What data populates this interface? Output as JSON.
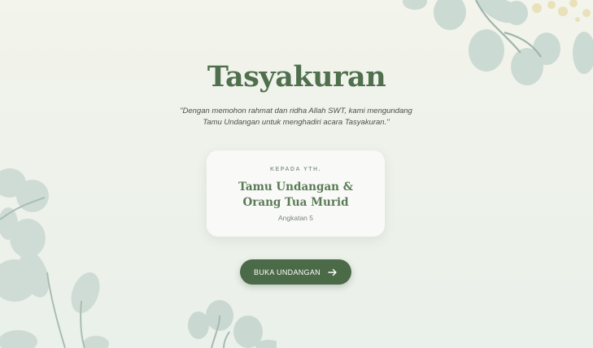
{
  "hero": {
    "title": "Tasyakuran",
    "quote_line1": "\"Dengan memohon rahmat dan ridha Allah SWT, kami mengundang",
    "quote_line2": "Tamu Undangan untuk menghadiri acara Tasyakuran.\""
  },
  "guest_card": {
    "label": "KEPADA YTH.",
    "name": "Tamu Undangan & Orang Tua Murid",
    "subtitle": "Angkatan 5"
  },
  "open_button": {
    "label": "BUKA UNDANGAN",
    "icon": "arrow-right-icon"
  },
  "colors": {
    "primary_green": "#4b6a47",
    "title_green": "#4f6f4d",
    "leaf": "#c9d8d2",
    "accent_gold": "#e8ddb0"
  }
}
